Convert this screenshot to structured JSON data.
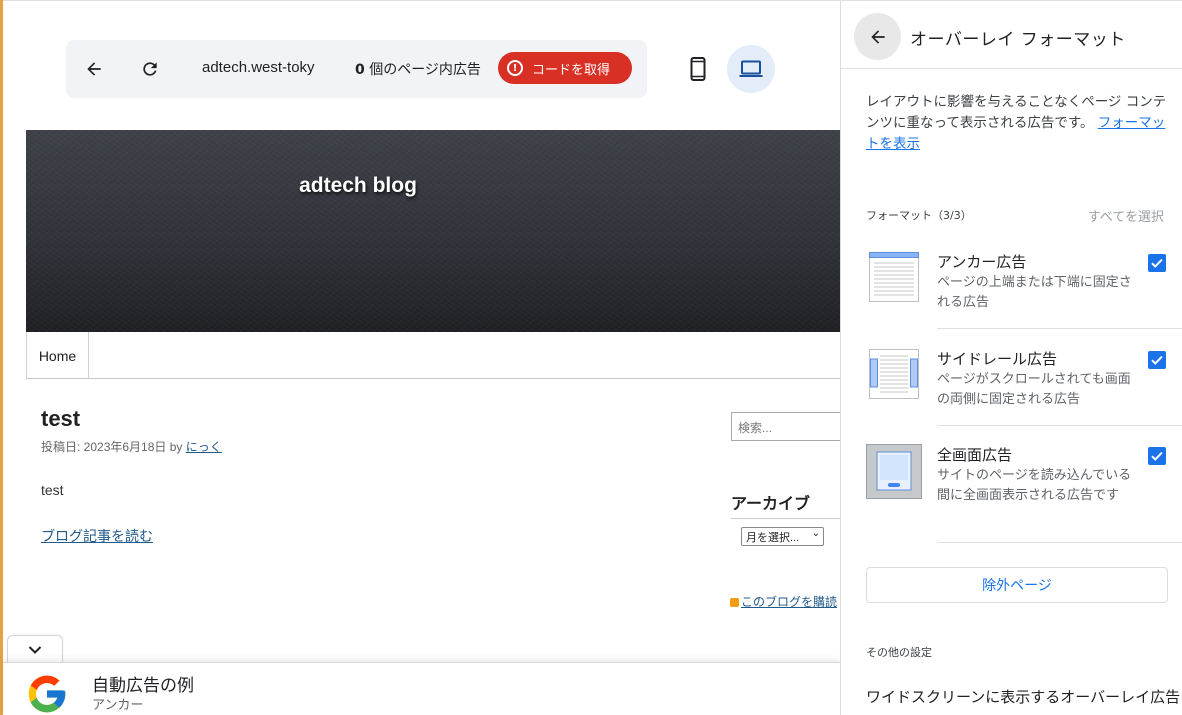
{
  "toolbar": {
    "domain": "adtech.west-toky",
    "ad_count": "0",
    "ad_count_suffix": " 個のページ内広告",
    "get_code_label": "コードを取得"
  },
  "site": {
    "banner_title": "adtech blog",
    "nav_home": "Home",
    "post_title": "test",
    "post_meta_prefix": "投稿日: 2023年6月18日 by ",
    "post_author": "にっく",
    "post_body": "test",
    "read_more": "ブログ記事を読む",
    "search_placeholder": "検索...",
    "archive_heading": "アーカイブ",
    "month_select": "月を選択...",
    "rss_link": "このブログを購読"
  },
  "anchor_ad": {
    "title": "自動広告の例",
    "subtitle": "アンカー"
  },
  "panel": {
    "title": "オーバーレイ フォーマット",
    "description": "レイアウトに影響を与えることなくページ コンテンツに重なって表示される広告です。",
    "description_link": "フォーマットを表示",
    "formats_label": "フォーマット（3/3）",
    "select_all": "すべてを選択",
    "formats": [
      {
        "name": "アンカー広告",
        "desc": "ページの上端または下端に固定される広告",
        "icon": "anchor-ad-icon",
        "checked": true
      },
      {
        "name": "サイドレール広告",
        "desc": "ページがスクロールされても画面の両側に固定される広告",
        "icon": "side-rail-ad-icon",
        "checked": true
      },
      {
        "name": "全画面広告",
        "desc": "サイトのページを読み込んでいる間に全画面表示される広告です",
        "icon": "vignette-ad-icon",
        "checked": true
      }
    ],
    "exclude_pages": "除外ページ",
    "other_settings_label": "その他の設定",
    "wide_setting": "ワイドスクリーンに表示するオーバーレイ広告"
  },
  "colors": {
    "accent": "#1a73e8",
    "get_code_red": "#d93025",
    "laptop_selected_bg": "#e3ecf9"
  }
}
